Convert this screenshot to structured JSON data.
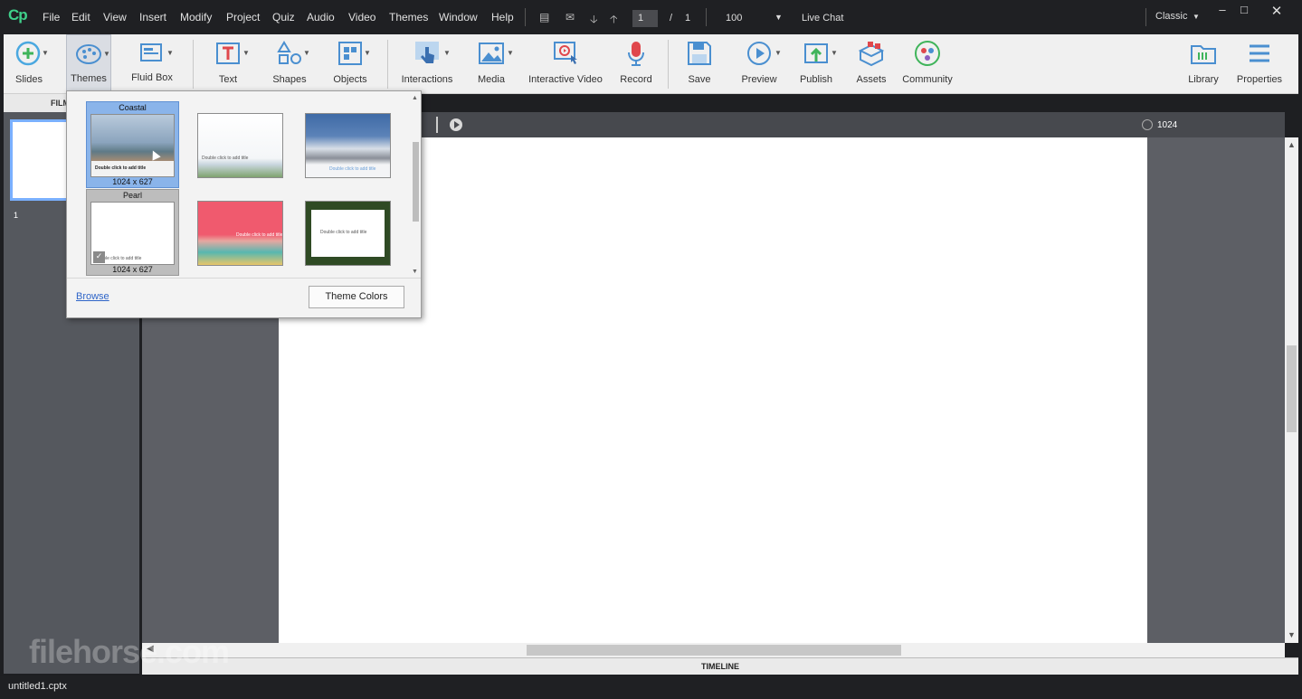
{
  "app": {
    "logo": "Cp",
    "workspace": "Classic"
  },
  "menu": [
    "File",
    "Edit",
    "View",
    "Insert",
    "Modify",
    "Project",
    "Quiz",
    "Audio",
    "Video",
    "Themes",
    "Window",
    "Help"
  ],
  "nav": {
    "page_current": "1",
    "page_sep": "/",
    "page_total": "1",
    "zoom": "100",
    "live_chat": "Live Chat"
  },
  "toolbar": {
    "slides": "Slides",
    "themes": "Themes",
    "fluid_box": "Fluid Box",
    "text": "Text",
    "shapes": "Shapes",
    "objects": "Objects",
    "interactions": "Interactions",
    "media": "Media",
    "interactive_video": "Interactive Video",
    "record": "Record",
    "save": "Save",
    "preview": "Preview",
    "publish": "Publish",
    "assets": "Assets",
    "community": "Community",
    "library": "Library",
    "properties": "Properties"
  },
  "filmstrip": {
    "header": "FILM",
    "slide_number": "1"
  },
  "ruler": {
    "width_label": "1024"
  },
  "themes_popup": {
    "themes": [
      {
        "name": "Coastal",
        "size": "1024 x 627",
        "caption": "Double click to add title"
      },
      {
        "name": "",
        "size": "",
        "caption": "Double click to add title"
      },
      {
        "name": "",
        "size": "",
        "caption": "Double click to add title"
      },
      {
        "name": "Pearl",
        "size": "1024 x 627",
        "caption": "Double click to add title"
      },
      {
        "name": "",
        "size": "",
        "caption": "Double click to add title"
      },
      {
        "name": "",
        "size": "",
        "caption": "Double click to add title"
      }
    ],
    "browse": "Browse",
    "theme_colors": "Theme Colors"
  },
  "timeline": "TIMELINE",
  "status": {
    "filename": "untitled1.cptx"
  },
  "watermark": "filehorse.com",
  "colors": {
    "accent": "#3fd08a",
    "selection": "#8ab4ea",
    "link": "#2f65c8"
  }
}
